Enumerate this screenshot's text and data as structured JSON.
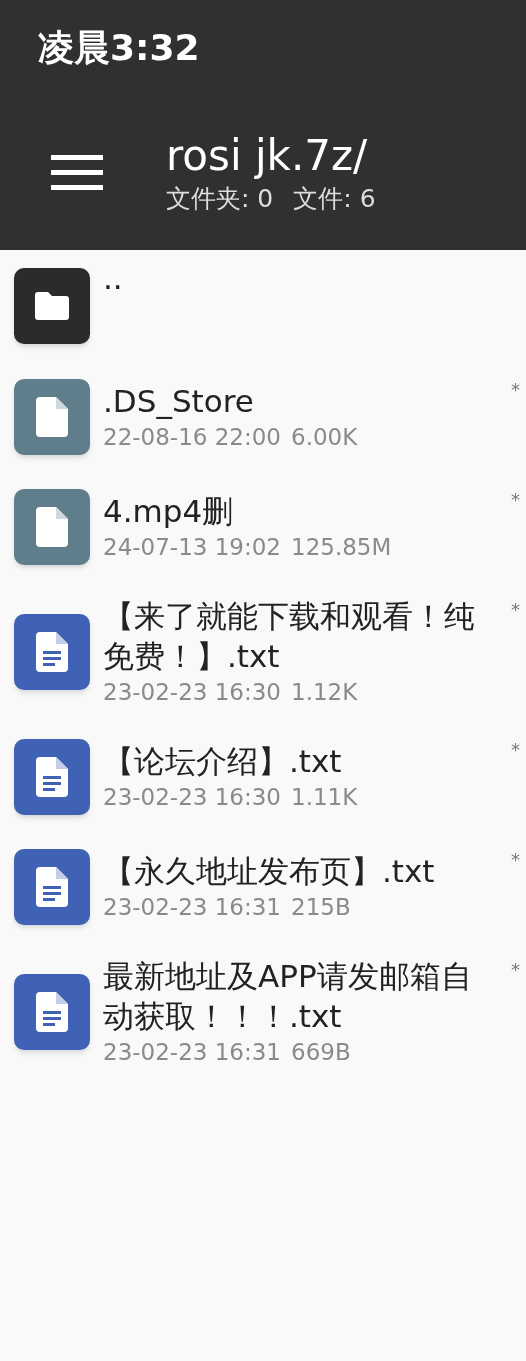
{
  "status_bar": {
    "time": "凌晨3:32"
  },
  "toolbar": {
    "title": "rosi jk.7z/",
    "folders": "文件夹: 0",
    "files": "文件: 6"
  },
  "items": [
    {
      "kind": "parent",
      "name": ".."
    },
    {
      "kind": "file",
      "name": ".DS_Store",
      "date": "22-08-16 22:00",
      "size": "6.00K",
      "mark": "*"
    },
    {
      "kind": "file",
      "name": "4.mp4删",
      "date": "24-07-13 19:02",
      "size": "125.85M",
      "mark": "*"
    },
    {
      "kind": "text",
      "name": "【来了就能下载和观看！纯免费！】.txt",
      "date": "23-02-23 16:30",
      "size": "1.12K",
      "mark": "*"
    },
    {
      "kind": "text",
      "name": "【论坛介绍】.txt",
      "date": "23-02-23 16:30",
      "size": "1.11K",
      "mark": "*"
    },
    {
      "kind": "text",
      "name": "【永久地址发布页】.txt",
      "date": "23-02-23 16:31",
      "size": "215B",
      "mark": "*"
    },
    {
      "kind": "text",
      "name": "最新地址及APP请发邮箱自动获取！！！.txt",
      "date": "23-02-23 16:31",
      "size": "669B",
      "mark": "*"
    }
  ]
}
